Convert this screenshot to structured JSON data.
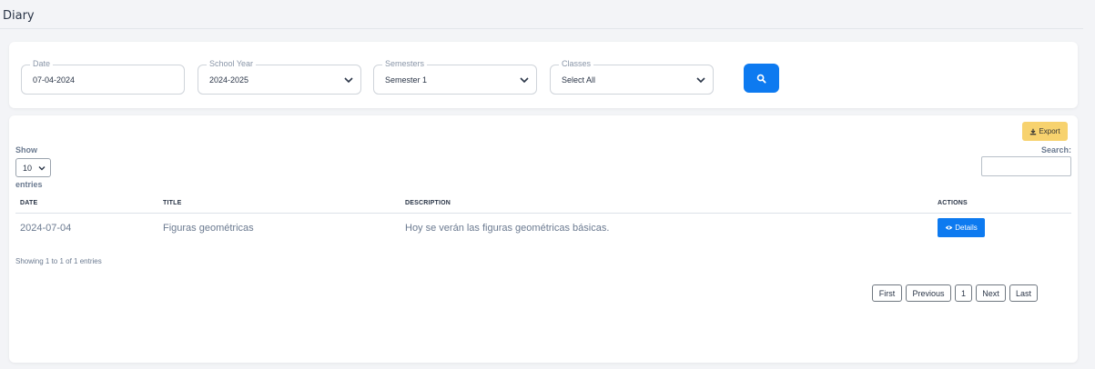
{
  "page": {
    "title": "Diary"
  },
  "filters": {
    "date": {
      "label": "Date",
      "value": "07-04-2024"
    },
    "school_year": {
      "label": "School Year",
      "value": "2024-2025"
    },
    "semesters": {
      "label": "Semesters",
      "value": "Semester 1"
    },
    "classes": {
      "label": "Classes",
      "value": "Select All"
    },
    "search_icon": "search-icon"
  },
  "toolbar": {
    "export_label": "Export",
    "export_icon": "download-icon"
  },
  "table_controls": {
    "show_label": "Show",
    "page_length": "10",
    "entries_label": "entries",
    "search_label": "Search:",
    "search_value": ""
  },
  "table": {
    "columns": [
      "DATE",
      "TITLE",
      "DESCRIPTION",
      "ACTIONS"
    ],
    "rows": [
      {
        "date": "2024-07-04",
        "title": "Figuras geométricas",
        "description": "Hoy se verán las figuras geométricas básicas.",
        "action_label": "Details"
      }
    ],
    "info": "Showing 1 to 1 of 1 entries"
  },
  "pagination": {
    "first": "First",
    "previous": "Previous",
    "current": "1",
    "next": "Next",
    "last": "Last"
  },
  "colors": {
    "primary": "#0d7af0",
    "export": "#f7d26e",
    "background": "#f3f4f7"
  }
}
